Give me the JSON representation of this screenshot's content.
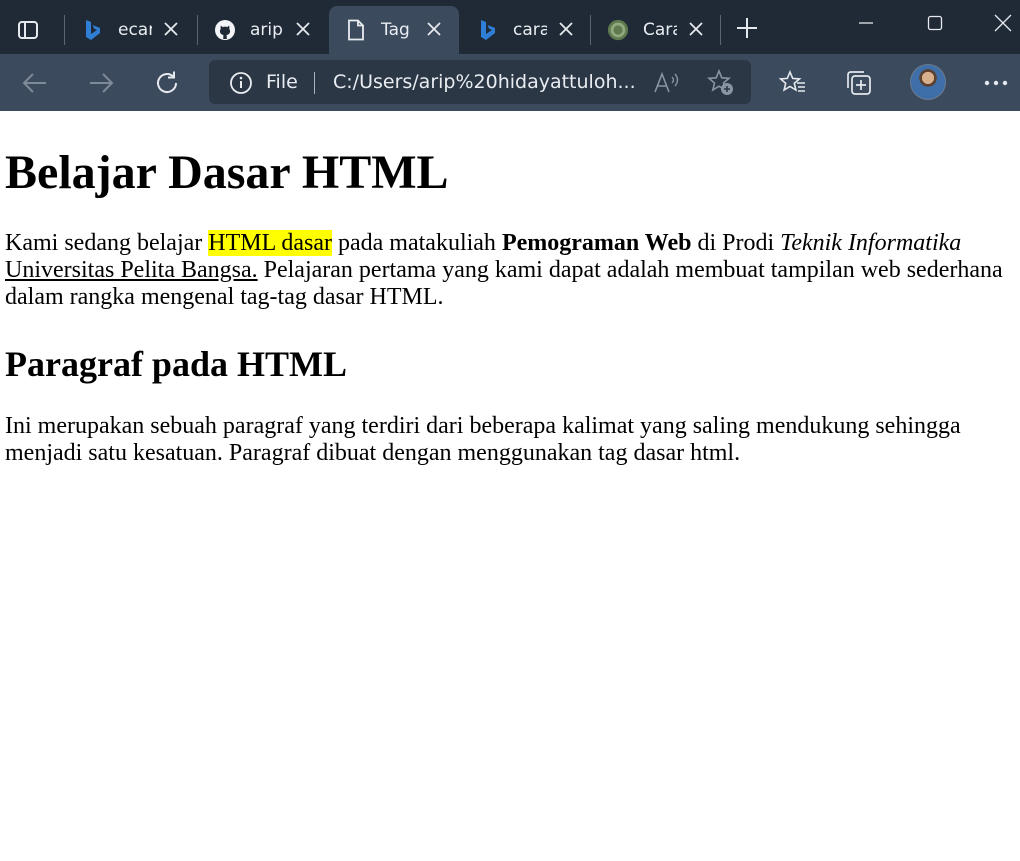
{
  "browser": {
    "tabs": [
      {
        "title": "ecar",
        "favicon": "bing-icon",
        "active": false
      },
      {
        "title": "aripl",
        "favicon": "github-icon",
        "active": false
      },
      {
        "title": "Tag",
        "favicon": "page-icon",
        "active": true
      },
      {
        "title": "cara",
        "favicon": "bing-icon",
        "active": false
      },
      {
        "title": "Cara",
        "favicon": "wikihow-icon",
        "active": false
      }
    ],
    "address": {
      "scheme_label": "File",
      "url": "C:/Users/arip%20hidayattuloh..."
    },
    "colors": {
      "tabstrip": "#202a36",
      "toolbar": "#3b4a5c",
      "addressbar": "#2b3744"
    }
  },
  "document": {
    "heading": "Belajar Dasar HTML",
    "intro": {
      "t1": "Kami sedang belajar ",
      "highlight": "HTML dasar",
      "t2": " pada matakuliah ",
      "bold": "Pemograman Web",
      "t3": " di Prodi ",
      "italic": "Teknik Informatika",
      "t4": " ",
      "underline": "Universitas Pelita Bangsa.",
      "t5": " Pelajaran pertama yang kami dapat adalah membuat tampilan web sederhana dalam rangka mengenal tag-tag dasar HTML."
    },
    "subheading": "Paragraf pada HTML",
    "paragraph": "Ini merupakan sebuah paragraf yang terdiri dari beberapa kalimat yang saling mendukung sehingga menjadi satu kesatuan. Paragraf dibuat dengan menggunakan tag dasar html.",
    "highlight_color": "#ffff00"
  }
}
